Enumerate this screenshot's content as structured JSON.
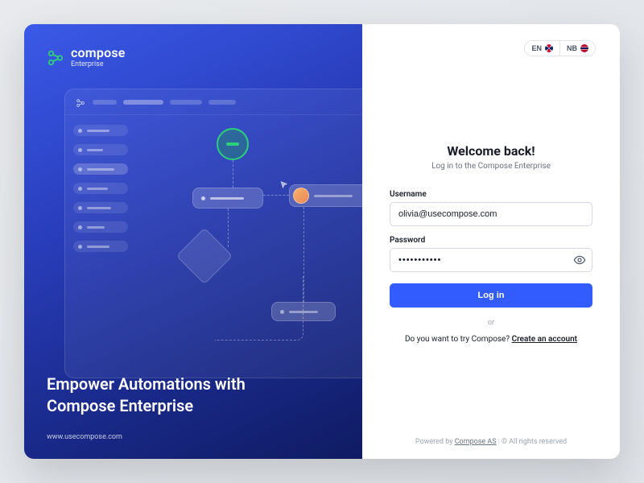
{
  "brand": {
    "name": "compose",
    "sub": "Enterprise"
  },
  "tagline_l1": "Empower Automations with",
  "tagline_l2": "Compose Enterprise",
  "site": "www.usecompose.com",
  "lang": {
    "en": "EN",
    "nb": "NB"
  },
  "welcome": "Welcome back!",
  "subtitle": "Log in to the Compose Enterprise",
  "labels": {
    "username": "Username",
    "password": "Password"
  },
  "fields": {
    "username": "olivia@usecompose.com",
    "password": "•••••••••••"
  },
  "login_btn": "Log in",
  "or": "or",
  "create_prefix": "Do you want to try Compose? ",
  "create_link": "Create an account",
  "footer": {
    "powered": "Powered by ",
    "company": "Compose AS",
    "rights": "© All rights reserved"
  }
}
